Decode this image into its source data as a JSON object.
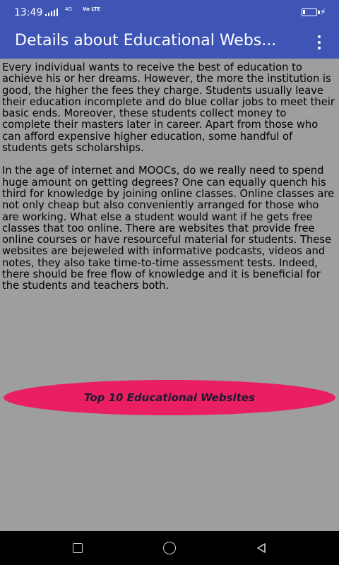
{
  "status_bar": {
    "time": "13:49",
    "network": "4G",
    "lte": "Vo LTE",
    "charging_icon": "charging-bolt-icon"
  },
  "app_bar": {
    "title": "Details about Educational Webs...",
    "menu_icon": "overflow-menu-icon"
  },
  "content": {
    "paragraphs": [
      "Every individual wants to receive the best of education to achieve his or her dreams. However, the more the institution is good, the higher the fees they charge. Students usually leave their education incomplete and do blue collar jobs to meet their basic ends. Moreover, these students collect money to complete their masters later in career. Apart from those who can afford expensive higher education, some handful of students gets scholarships.",
      "In the age of internet and MOOCs, do we really need to spend huge amount on getting degrees? One can equally quench his third for knowledge by joining online classes. Online classes are not only cheap but also conveniently arranged for those who are working. What else a student would want if he gets free classes that too online. There are websites that provide free online courses or have resourceful material for students. These websites are bejeweled with informative podcasts, videos and notes, they also take time-to-time assessment tests. Indeed, there should be free flow of knowledge and it is beneficial for the students and teachers both."
    ]
  },
  "cta": {
    "label": "Top 10 Educational Websites"
  },
  "nav_bar": {
    "icons": [
      "recents-square-icon",
      "home-circle-icon",
      "back-triangle-icon"
    ]
  },
  "colors": {
    "primary": "#3f55b5",
    "background": "#9e9e9e",
    "accent": "#e91e63",
    "button_text": "#1a1a2e"
  }
}
